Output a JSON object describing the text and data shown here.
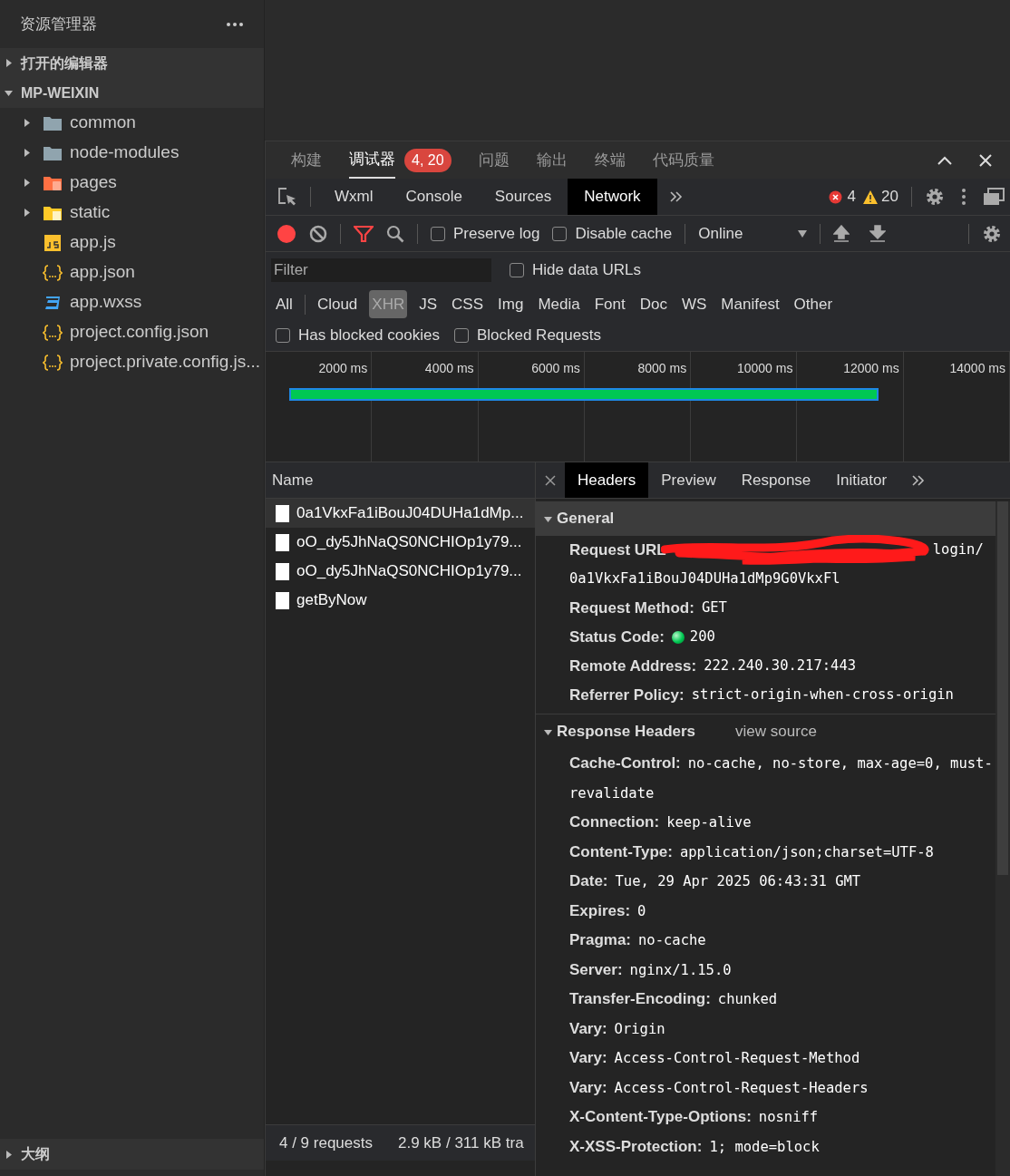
{
  "sidebar": {
    "title": "资源管理器",
    "sections": [
      {
        "label": "打开的编辑器",
        "expanded": false
      },
      {
        "label": "MP-WEIXIN",
        "expanded": true
      }
    ],
    "files": [
      {
        "name": "common",
        "kind": "folder",
        "expanded": false
      },
      {
        "name": "node-modules",
        "kind": "folder",
        "expanded": false
      },
      {
        "name": "pages",
        "kind": "pages",
        "expanded": false
      },
      {
        "name": "static",
        "kind": "static",
        "expanded": false
      },
      {
        "name": "app.js",
        "kind": "js"
      },
      {
        "name": "app.json",
        "kind": "json"
      },
      {
        "name": "app.wxss",
        "kind": "css"
      },
      {
        "name": "project.config.json",
        "kind": "json"
      },
      {
        "name": "project.private.config.js...",
        "kind": "json"
      }
    ],
    "outline": {
      "label": "大纲",
      "expanded": false
    }
  },
  "panel_tabs": [
    {
      "label": "构建",
      "selected": false
    },
    {
      "label": "调试器",
      "selected": true,
      "badge": "4, 20"
    },
    {
      "label": "问题",
      "selected": false
    },
    {
      "label": "输出",
      "selected": false
    },
    {
      "label": "终端",
      "selected": false
    },
    {
      "label": "代码质量",
      "selected": false
    }
  ],
  "devtools_tabs": [
    {
      "label": "Wxml",
      "selected": false
    },
    {
      "label": "Console",
      "selected": false
    },
    {
      "label": "Sources",
      "selected": false
    },
    {
      "label": "Network",
      "selected": true
    }
  ],
  "error_count": "4",
  "warning_count": "20",
  "network_toolbar": {
    "recording": true,
    "preserve_log": {
      "label": "Preserve log",
      "checked": false
    },
    "disable_cache": {
      "label": "Disable cache",
      "checked": false
    },
    "throttling": "Online"
  },
  "filter": {
    "placeholder": "Filter",
    "hide_data_urls": false,
    "hide_data_urls_label": "Hide data URLs"
  },
  "type_filters": [
    {
      "label": "All",
      "selected": false
    },
    {
      "label": "Cloud",
      "selected": false
    },
    {
      "label": "XHR",
      "selected": true
    },
    {
      "label": "JS",
      "selected": false
    },
    {
      "label": "CSS",
      "selected": false
    },
    {
      "label": "Img",
      "selected": false
    },
    {
      "label": "Media",
      "selected": false
    },
    {
      "label": "Font",
      "selected": false
    },
    {
      "label": "Doc",
      "selected": false
    },
    {
      "label": "WS",
      "selected": false
    },
    {
      "label": "Manifest",
      "selected": false
    },
    {
      "label": "Other",
      "selected": false
    }
  ],
  "extra_filters": [
    {
      "label": "Has blocked cookies",
      "checked": false
    },
    {
      "label": "Blocked Requests",
      "checked": false
    }
  ],
  "timeline_ticks": [
    "2000 ms",
    "4000 ms",
    "6000 ms",
    "8000 ms",
    "10000 ms",
    "12000 ms",
    "14000 ms"
  ],
  "requests": {
    "column": "Name",
    "rows": [
      {
        "name": "0a1VkxFa1iBouJ04DUHa1dMp...",
        "selected": true
      },
      {
        "name": "oO_dy5JhNaQS0NCHIOp1y79...",
        "selected": false
      },
      {
        "name": "oO_dy5JhNaQS0NCHIOp1y79...",
        "selected": false
      },
      {
        "name": "getByNow",
        "selected": false
      }
    ]
  },
  "detail_tabs": [
    {
      "label": "Headers",
      "selected": true
    },
    {
      "label": "Preview",
      "selected": false
    },
    {
      "label": "Response",
      "selected": false
    },
    {
      "label": "Initiator",
      "selected": false
    }
  ],
  "general": {
    "title": "General",
    "expanded": true,
    "request_url": {
      "label": "Request URL",
      "value_visible": "login/",
      "value_line2": "0a1VkxFa1iBouJ04DUHa1dMp9G0VkxFl"
    },
    "rows": [
      {
        "label": "Request Method:",
        "value": "GET"
      },
      {
        "label": "Status Code:",
        "value": "200",
        "kind": "status"
      },
      {
        "label": "Remote Address:",
        "value": "222.240.30.217:443"
      },
      {
        "label": "Referrer Policy:",
        "value": "strict-origin-when-cross-origin"
      }
    ]
  },
  "response_headers": {
    "title": "Response Headers",
    "expanded": true,
    "view_source": "view source",
    "rows": [
      {
        "label": "Cache-Control:",
        "value": "no-cache, no-store, max-age=0, must-revalidate"
      },
      {
        "label": "Connection:",
        "value": "keep-alive"
      },
      {
        "label": "Content-Type:",
        "value": "application/json;charset=UTF-8"
      },
      {
        "label": "Date:",
        "value": "Tue, 29 Apr 2025 06:43:31 GMT"
      },
      {
        "label": "Expires:",
        "value": "0"
      },
      {
        "label": "Pragma:",
        "value": "no-cache"
      },
      {
        "label": "Server:",
        "value": "nginx/1.15.0"
      },
      {
        "label": "Transfer-Encoding:",
        "value": "chunked"
      },
      {
        "label": "Vary:",
        "value": "Origin"
      },
      {
        "label": "Vary:",
        "value": "Access-Control-Request-Method"
      },
      {
        "label": "Vary:",
        "value": "Access-Control-Request-Headers"
      },
      {
        "label": "X-Content-Type-Options:",
        "value": "nosniff"
      },
      {
        "label": "X-XSS-Protection:",
        "value": "1; mode=block"
      }
    ]
  },
  "status_bar": [
    "4 / 9 requests",
    "2.9 kB / 311 kB tra"
  ]
}
